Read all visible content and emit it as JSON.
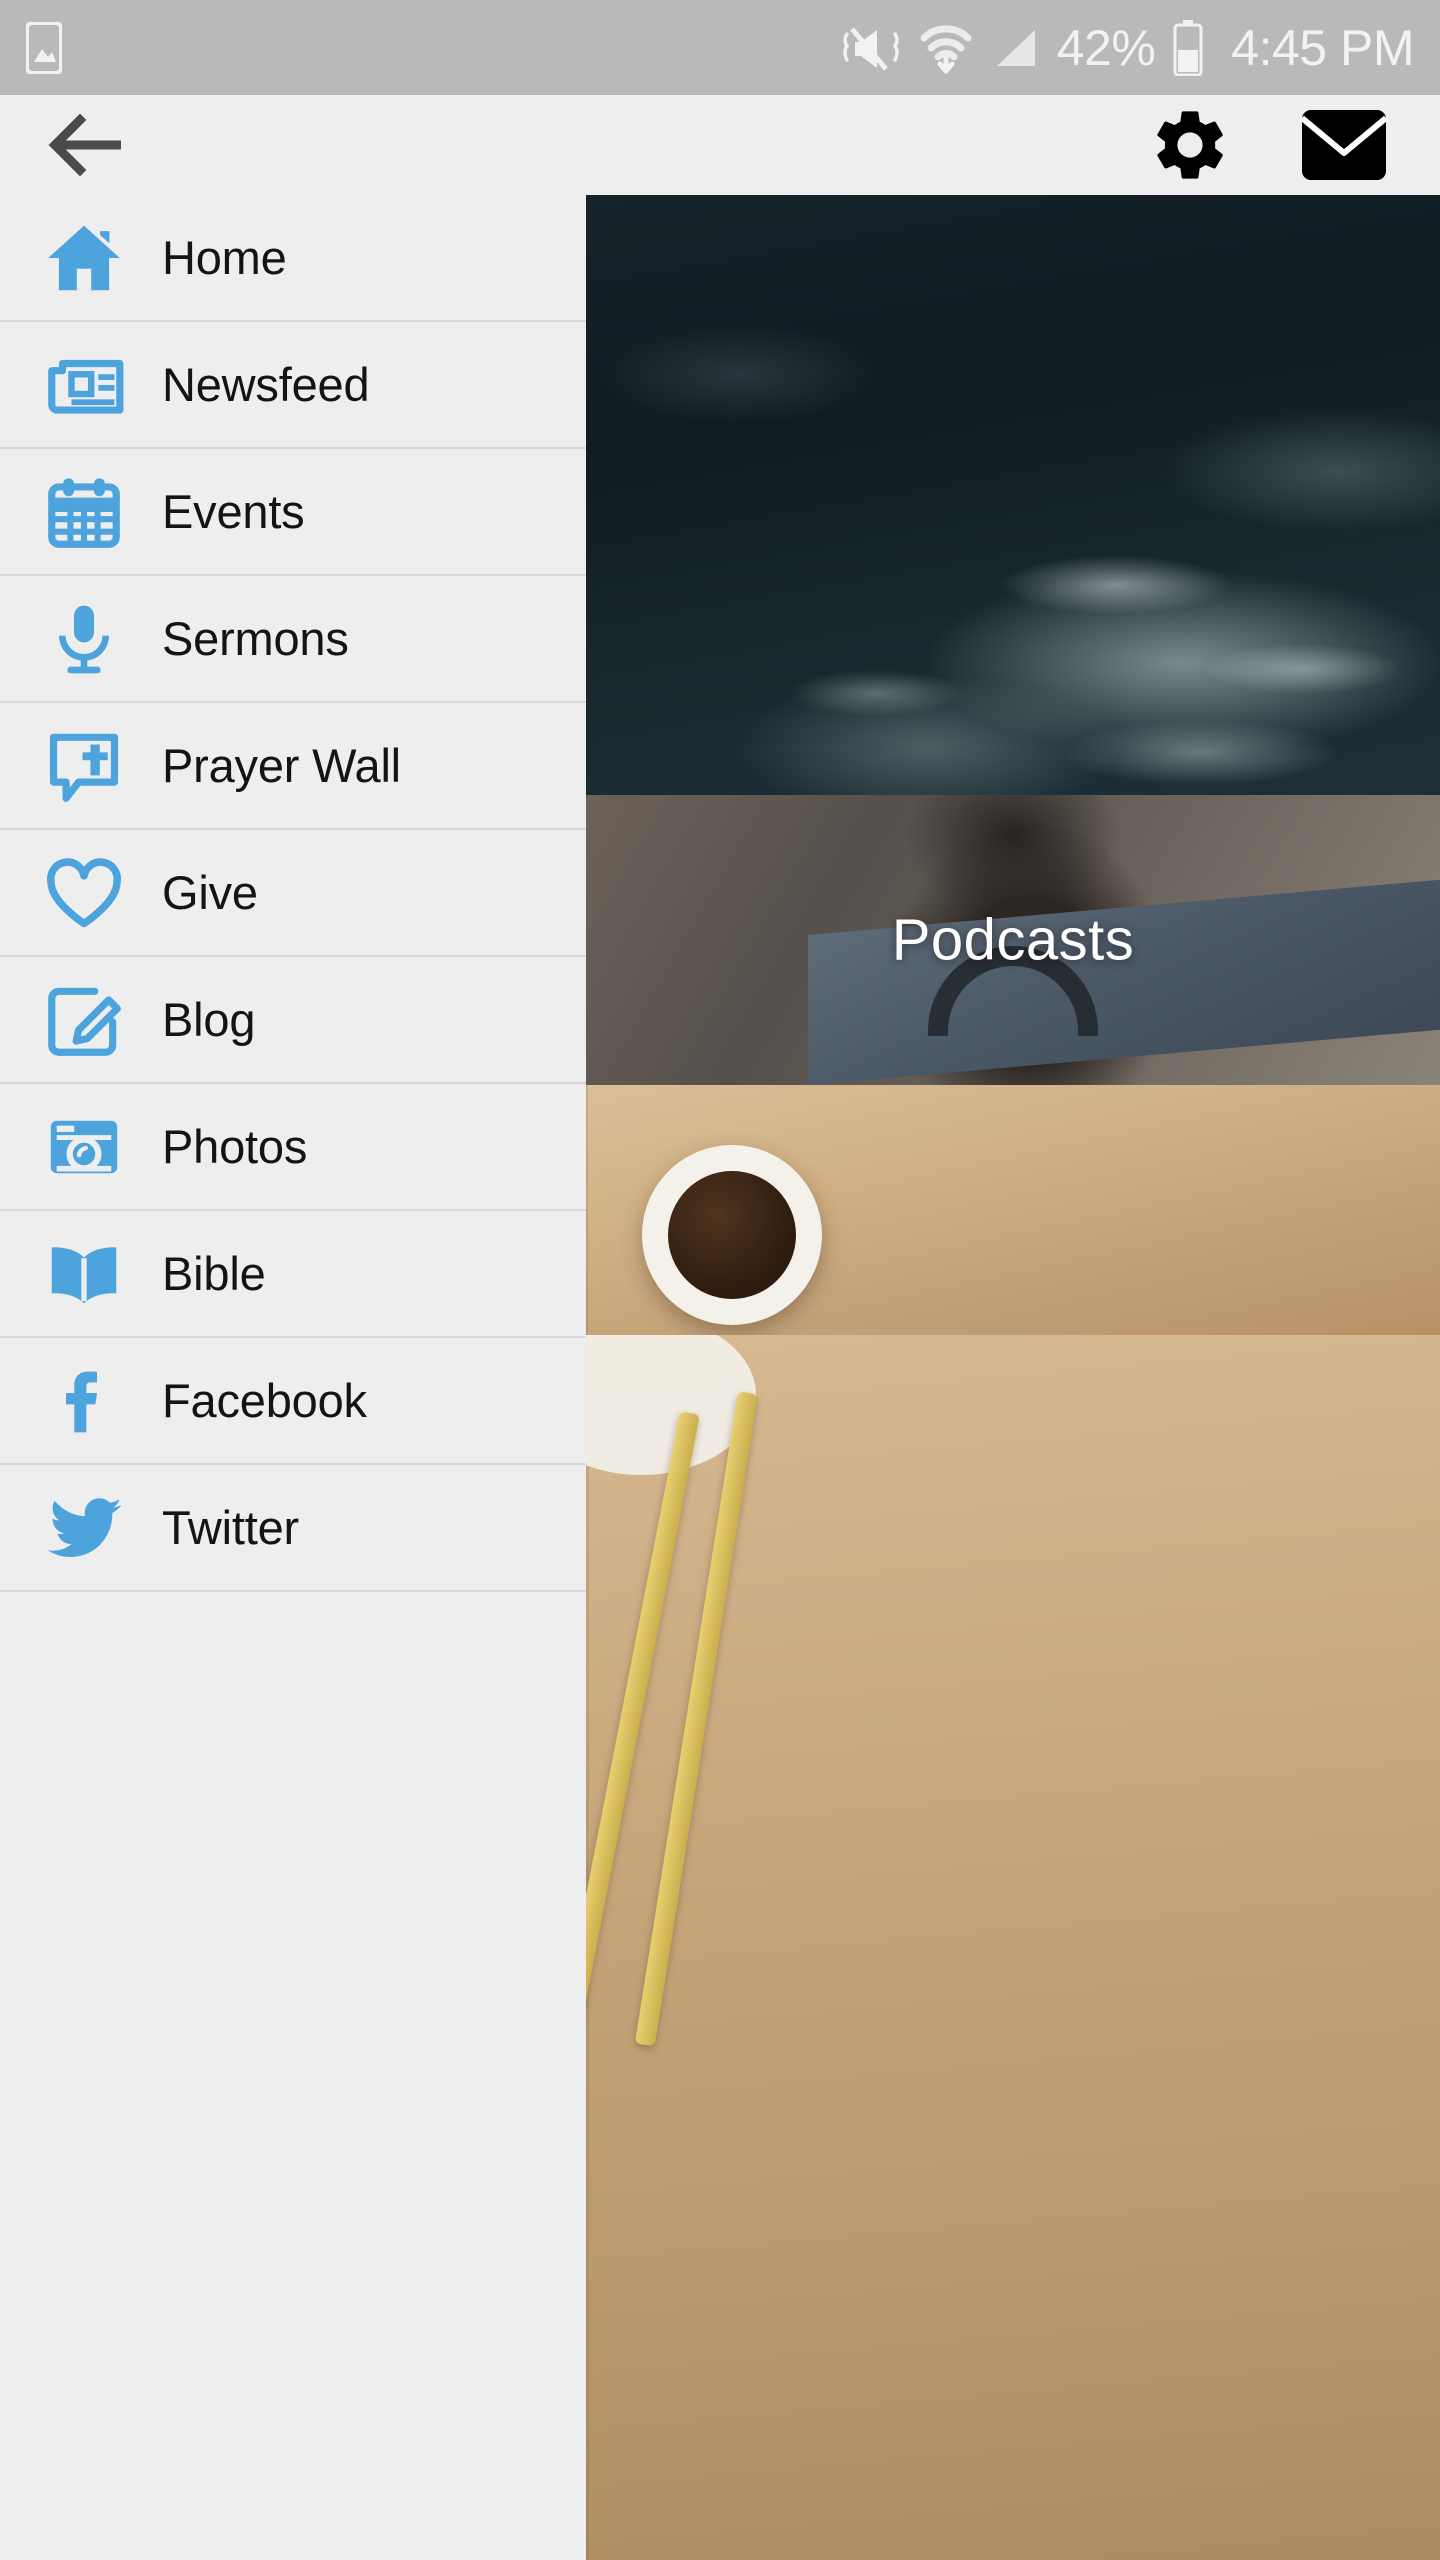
{
  "status_bar": {
    "battery_percent": "42%",
    "time": "4:45 PM",
    "icons": [
      "image-icon",
      "mute-vibrate-icon",
      "wifi-icon",
      "signal-icon",
      "battery-icon"
    ],
    "background_color": "#b9b9b9",
    "text_color": "#f2f2f2"
  },
  "app_bar": {
    "back_icon": "back-arrow-icon",
    "settings_icon": "gear-icon",
    "mail_icon": "envelope-icon",
    "icon_color": "#000000",
    "back_color": "#4a4a4a",
    "background_color": "#eeeeee"
  },
  "drawer": {
    "accent_color": "#4da3dc",
    "background_color": "#eeeeee",
    "divider_color": "#d8d8d8",
    "items": [
      {
        "label": "Home",
        "icon": "home-icon"
      },
      {
        "label": "Newsfeed",
        "icon": "newspaper-icon"
      },
      {
        "label": "Events",
        "icon": "calendar-icon"
      },
      {
        "label": "Sermons",
        "icon": "microphone-icon"
      },
      {
        "label": "Prayer Wall",
        "icon": "speech-bubble-cross-icon"
      },
      {
        "label": "Give",
        "icon": "heart-icon"
      },
      {
        "label": "Blog",
        "icon": "pencil-edit-icon"
      },
      {
        "label": "Photos",
        "icon": "camera-icon"
      },
      {
        "label": "Bible",
        "icon": "open-book-icon"
      },
      {
        "label": "Facebook",
        "icon": "facebook-icon"
      },
      {
        "label": "Twitter",
        "icon": "twitter-bird-icon"
      }
    ]
  },
  "content": {
    "cards": [
      {
        "name": "ocean-card",
        "label": ""
      },
      {
        "name": "podcasts-card",
        "label": "Podcasts"
      },
      {
        "name": "coffee-card",
        "label": ""
      },
      {
        "name": "wood-card",
        "label": ""
      }
    ],
    "podcasts_label": "Podcasts"
  }
}
